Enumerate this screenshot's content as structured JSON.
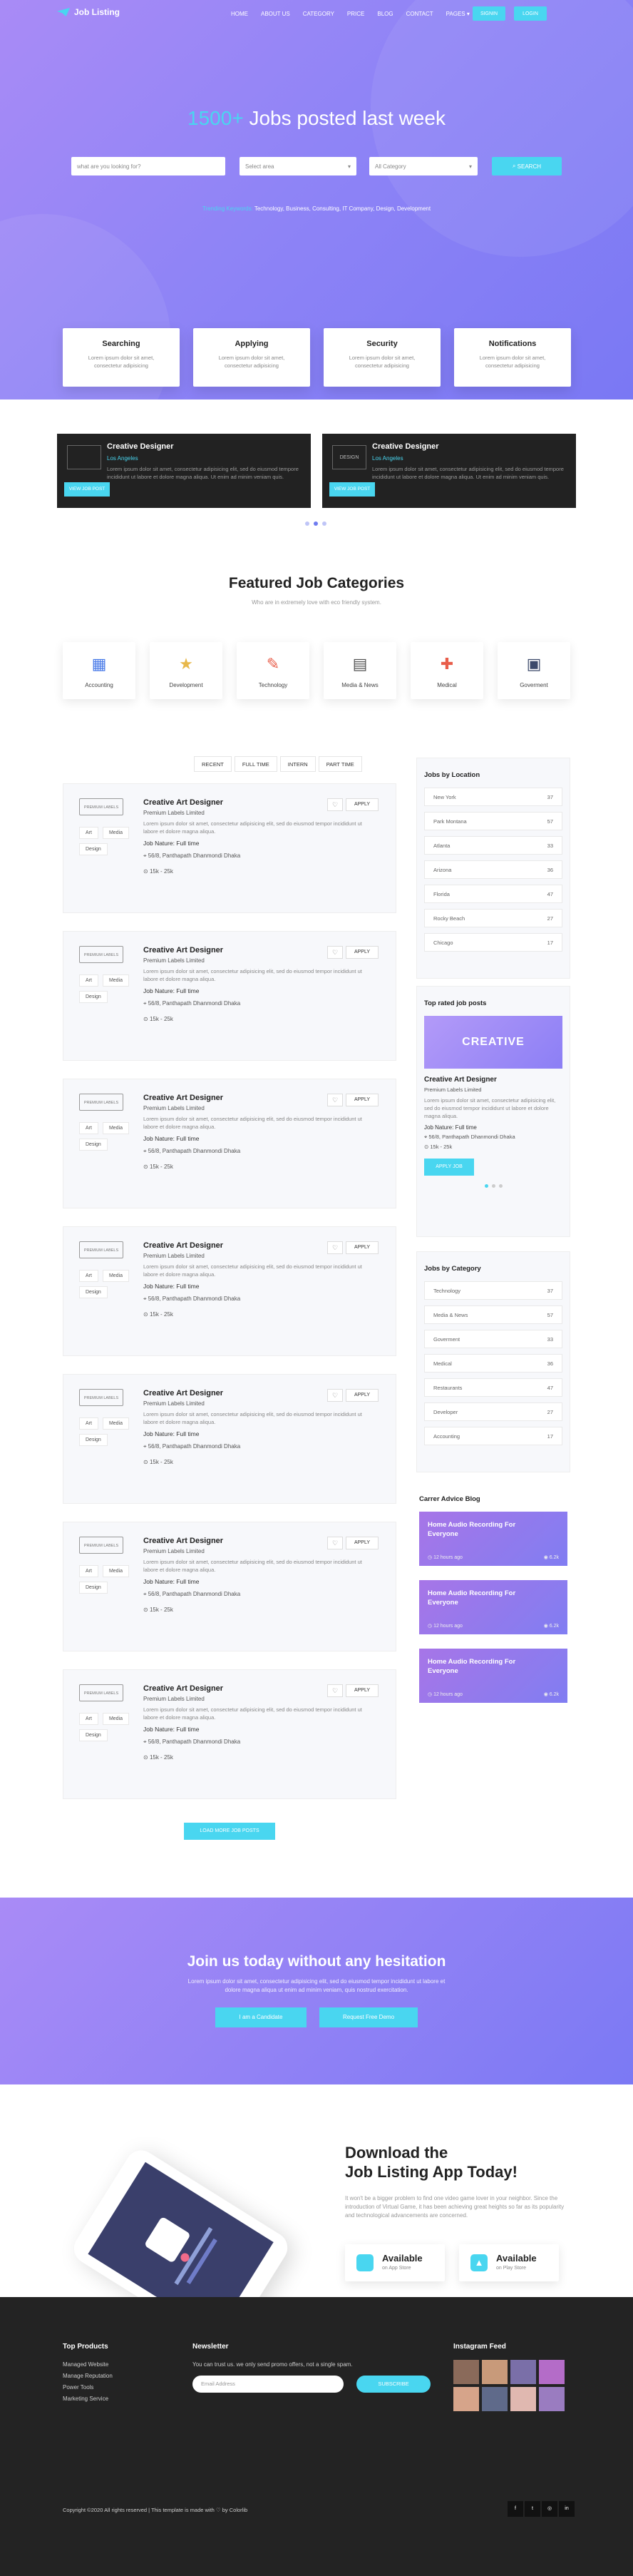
{
  "nav": {
    "brand": "Job Listing",
    "links": [
      "HOME",
      "ABOUT US",
      "CATEGORY",
      "PRICE",
      "BLOG",
      "CONTACT",
      "PAGES"
    ],
    "signin": "SIGNIN",
    "login": "LOGIN"
  },
  "hero": {
    "count": "1500+",
    "title": " Jobs posted last week",
    "search_placeholder": "what are you looking for?",
    "area_select": "Select area",
    "category_select": "All Category",
    "search_button": "SEARCH",
    "trending_label": "Trending Keywords:",
    "trending_items": "Technology, Business, Consulting, IT Company, Design, Development"
  },
  "features": [
    {
      "title": "Searching",
      "desc": "Lorem ipsum dolor sit amet, consectetur adipisicing"
    },
    {
      "title": "Applying",
      "desc": "Lorem ipsum dolor sit amet, consectetur adipisicing"
    },
    {
      "title": "Security",
      "desc": "Lorem ipsum dolor sit amet, consectetur adipisicing"
    },
    {
      "title": "Notifications",
      "desc": "Lorem ipsum dolor sit amet, consectetur adipisicing"
    }
  ],
  "slides": [
    {
      "title": "Creative Designer",
      "location": "Los Angeles",
      "desc": "Lorem ipsum dolor sit amet, consectetur adipisicing elit, sed do eiusmod tempore incididunt ut labore et dolore magna aliqua. Ut enim ad minim veniam quis.",
      "button": "VIEW JOB POST",
      "logo": ""
    },
    {
      "title": "Creative Designer",
      "location": "Los Angeles",
      "desc": "Lorem ipsum dolor sit amet, consectetur adipisicing elit, sed do eiusmod tempore incididunt ut labore et dolore magna aliqua. Ut enim ad minim veniam quis.",
      "button": "VIEW JOB POST",
      "logo": "DESIGN"
    }
  ],
  "categories_section": {
    "title": "Featured Job Categories",
    "subtitle": "Who are in extremely love with eco friendly system."
  },
  "categories": [
    {
      "label": "Accounting",
      "icon": "accounting-icon",
      "glyph": "▦"
    },
    {
      "label": "Development",
      "icon": "development-icon",
      "glyph": "★"
    },
    {
      "label": "Technology",
      "icon": "technology-icon",
      "glyph": "✎"
    },
    {
      "label": "Media & News",
      "icon": "media-news-icon",
      "glyph": "▤"
    },
    {
      "label": "Medical",
      "icon": "medical-icon",
      "glyph": "✚"
    },
    {
      "label": "Goverment",
      "icon": "government-icon",
      "glyph": "▣"
    }
  ],
  "job_tabs": [
    "RECENT",
    "FULL TIME",
    "INTERN",
    "PART TIME"
  ],
  "job": {
    "title": "Creative Art Designer",
    "company": "Premium Labels Limited",
    "desc": "Lorem ipsum dolor sit amet, consectetur adipisicing elit, sed do eiusmod tempor incididunt ut labore et dolore magna aliqua.",
    "nature": "Job Nature: Full time",
    "address": "56/8, Panthapath Dhanmondi Dhaka",
    "salary": "15k - 25k",
    "apply": "APPLY",
    "stamp": "PREMIUM LABELS",
    "tags": [
      "Art",
      "Media",
      "Design"
    ]
  },
  "load_more": "LOAD MORE JOB POSTS",
  "sidebar": {
    "locations_title": "Jobs by Location",
    "locations": [
      {
        "name": "New York",
        "count": "37"
      },
      {
        "name": "Park Montana",
        "count": "57"
      },
      {
        "name": "Atlanta",
        "count": "33"
      },
      {
        "name": "Arizona",
        "count": "36"
      },
      {
        "name": "Florida",
        "count": "47"
      },
      {
        "name": "Rocky Beach",
        "count": "27"
      },
      {
        "name": "Chicago",
        "count": "17"
      }
    ],
    "top_rated_title": "Top rated job posts",
    "top_rated_banner": "CREATIVE",
    "top_rated_button": "APPLY JOB",
    "category_title": "Jobs by Category",
    "categories": [
      {
        "name": "Technology",
        "count": "37"
      },
      {
        "name": "Media & News",
        "count": "57"
      },
      {
        "name": "Goverment",
        "count": "33"
      },
      {
        "name": "Medical",
        "count": "36"
      },
      {
        "name": "Restaurants",
        "count": "47"
      },
      {
        "name": "Developer",
        "count": "27"
      },
      {
        "name": "Accounting",
        "count": "17"
      }
    ],
    "blog_title": "Carrer Advice Blog",
    "blogs": [
      {
        "title": "Home Audio Recording For Everyone",
        "meta": "12 hours ago",
        "views": "6.2k"
      },
      {
        "title": "Home Audio Recording For Everyone",
        "meta": "12 hours ago",
        "views": "6.2k"
      },
      {
        "title": "Home Audio Recording For Everyone",
        "meta": "12 hours ago",
        "views": "6.2k"
      }
    ]
  },
  "cta": {
    "title": "Join us today without any hesitation",
    "desc": "Lorem ipsum dolor sit amet, consectetur adipisicing elit, sed do eiusmod tempor incididunt ut labore et dolore magna aliqua ut enim ad minim veniam, quis nostrud exercitation.",
    "candidate": "I am a Candidate",
    "request": "Request Free Demo"
  },
  "app": {
    "title_line1": "Download the",
    "title_line2": "Job Listing App Today!",
    "desc": "It won't be a bigger problem to find one video game lover in your neighbor. Since the introduction of Virtual Game, it has been achieving great heights so far as its popularity and technological advancements are concerned.",
    "apple_main": "Available",
    "apple_sub": "on App Store",
    "play_main": "Available",
    "play_sub": "on Play Store"
  },
  "footer": {
    "products_title": "Top Products",
    "products": [
      "Managed Website",
      "Manage Reputation",
      "Power Tools",
      "Marketing Service"
    ],
    "newsletter_title": "Newsletter",
    "newsletter_desc": "You can trust us. we only send promo offers, not a single spam.",
    "email_placeholder": "Email Address",
    "subscribe": "SUBSCRIBE",
    "instagram_title": "Instagram Feed",
    "copyright": "Copyright ©2020 All rights reserved | This template is made with ♡ by Colorlib",
    "social": [
      "f",
      "t",
      "◎",
      "in"
    ]
  },
  "colors": {
    "accent": "#49d6f0",
    "hero_start": "#a98bf6",
    "hero_end": "#7a78f4",
    "footer": "#232323"
  }
}
